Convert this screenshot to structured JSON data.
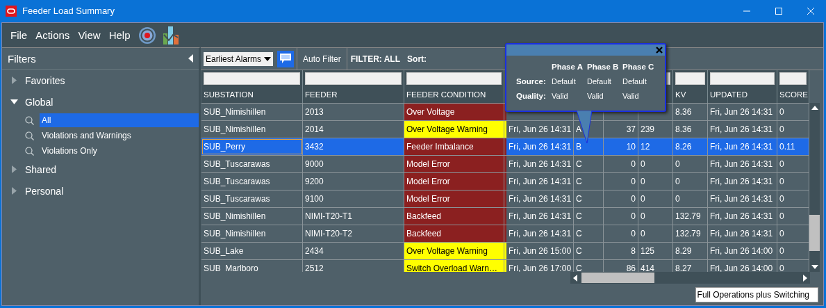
{
  "window": {
    "title": "Feeder Load Summary"
  },
  "menu": [
    "File",
    "Actions",
    "View",
    "Help"
  ],
  "sidebar": {
    "title": "Filters",
    "groups": [
      {
        "label": "Favorites",
        "expanded": false
      },
      {
        "label": "Global",
        "expanded": true,
        "children": [
          {
            "label": "All",
            "selected": true
          },
          {
            "label": "Violations and Warnings",
            "selected": false
          },
          {
            "label": "Violations Only",
            "selected": false
          }
        ]
      },
      {
        "label": "Shared",
        "expanded": false
      },
      {
        "label": "Personal",
        "expanded": false
      }
    ]
  },
  "toolbar": {
    "sort_order": "Earliest Alarms",
    "auto_filter": "Auto Filter",
    "filter": "FILTER: ALL",
    "sort": "Sort:"
  },
  "table": {
    "columns": [
      "SUBSTATION",
      "FEEDER",
      "FEEDER CONDITION",
      "",
      "",
      "",
      "",
      "KV",
      "UPDATED",
      "SCORE"
    ],
    "rows": [
      {
        "cells": [
          "SUB_Nimishillen",
          "2013",
          "Over Voltage",
          "",
          "",
          "",
          "",
          "8.36",
          "Fri, Jun 26 14:31",
          "0"
        ],
        "kind": "violation",
        "selected": false
      },
      {
        "cells": [
          "SUB_Nimishillen",
          "2014",
          "Over Voltage Warning",
          "Fri, Jun 26 14:31",
          "A",
          "37",
          "239",
          "8.36",
          "Fri, Jun 26 14:31",
          "0"
        ],
        "kind": "warning",
        "selected": false
      },
      {
        "cells": [
          "SUB_Perry",
          "3432",
          "Feeder Imbalance",
          "Fri, Jun 26 14:31",
          "B",
          "10",
          "12",
          "8.26",
          "Fri, Jun 26 14:31",
          "0.11"
        ],
        "kind": "violation",
        "selected": true
      },
      {
        "cells": [
          "SUB_Tuscarawas",
          "9000",
          "Model Error",
          "Fri, Jun 26 14:31",
          "C",
          "0",
          "0",
          "0",
          "Fri, Jun 26 14:31",
          "0"
        ],
        "kind": "violation",
        "selected": false
      },
      {
        "cells": [
          "SUB_Tuscarawas",
          "9200",
          "Model Error",
          "Fri, Jun 26 14:31",
          "C",
          "0",
          "0",
          "0",
          "Fri, Jun 26 14:31",
          "0"
        ],
        "kind": "violation",
        "selected": false
      },
      {
        "cells": [
          "SUB_Tuscarawas",
          "9100",
          "Model Error",
          "Fri, Jun 26 14:31",
          "C",
          "0",
          "0",
          "0",
          "Fri, Jun 26 14:31",
          "0"
        ],
        "kind": "violation",
        "selected": false
      },
      {
        "cells": [
          "SUB_Nimishillen",
          "NIMI-T20-T1",
          "Backfeed",
          "Fri, Jun 26 14:31",
          "C",
          "0",
          "0",
          "132.79",
          "Fri, Jun 26 14:31",
          "0"
        ],
        "kind": "violation",
        "selected": false
      },
      {
        "cells": [
          "SUB_Nimishillen",
          "NIMI-T20-T2",
          "Backfeed",
          "Fri, Jun 26 14:31",
          "C",
          "0",
          "0",
          "132.79",
          "Fri, Jun 26 14:31",
          "0"
        ],
        "kind": "violation",
        "selected": false
      },
      {
        "cells": [
          "SUB_Lake",
          "2434",
          "Over Voltage Warning",
          "Fri, Jun 26 15:00",
          "C",
          "8",
          "125",
          "8.29",
          "Fri, Jun 26 14:00",
          "0"
        ],
        "kind": "warning",
        "selected": false
      },
      {
        "cells": [
          "SUB_Marlboro",
          "2512",
          "Switch Overload Warn…",
          "Fri, Jun 26 17:00",
          "C",
          "86",
          "414",
          "8.27",
          "Fri, Jun 26 14:00",
          "0"
        ],
        "kind": "warning",
        "selected": false
      }
    ]
  },
  "popup": {
    "headers": [
      "Phase A",
      "Phase B",
      "Phase C"
    ],
    "rows": [
      {
        "label": "Source:",
        "values": [
          "Default",
          "Default",
          "Default"
        ]
      },
      {
        "label": "Quality:",
        "values": [
          "Valid",
          "Valid",
          "Valid"
        ]
      }
    ]
  },
  "status_bar": {
    "mode": "Full Operations plus Switching"
  }
}
